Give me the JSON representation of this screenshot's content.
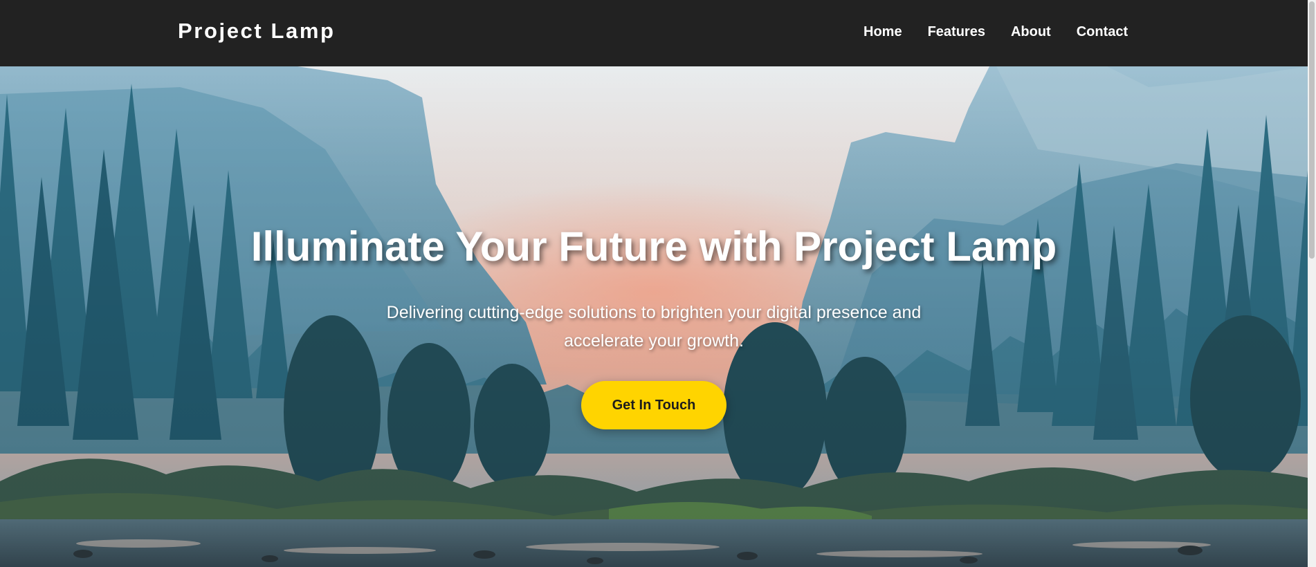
{
  "header": {
    "logo": "Project Lamp",
    "nav": [
      "Home",
      "Features",
      "About",
      "Contact"
    ]
  },
  "hero": {
    "title": "Illuminate Your Future with Project Lamp",
    "subtitle": "Delivering cutting-edge solutions to brighten your digital presence and accelerate your growth.",
    "cta_label": "Get In Touch"
  },
  "colors": {
    "header_bg": "#222222",
    "cta_bg": "#ffd400",
    "sky_warm": "#f5b5a2",
    "mountain": "#7aa8bf",
    "forest": "#2f6f84"
  },
  "icons": {
    "hero_image": "mountain-forest-river-landscape"
  }
}
